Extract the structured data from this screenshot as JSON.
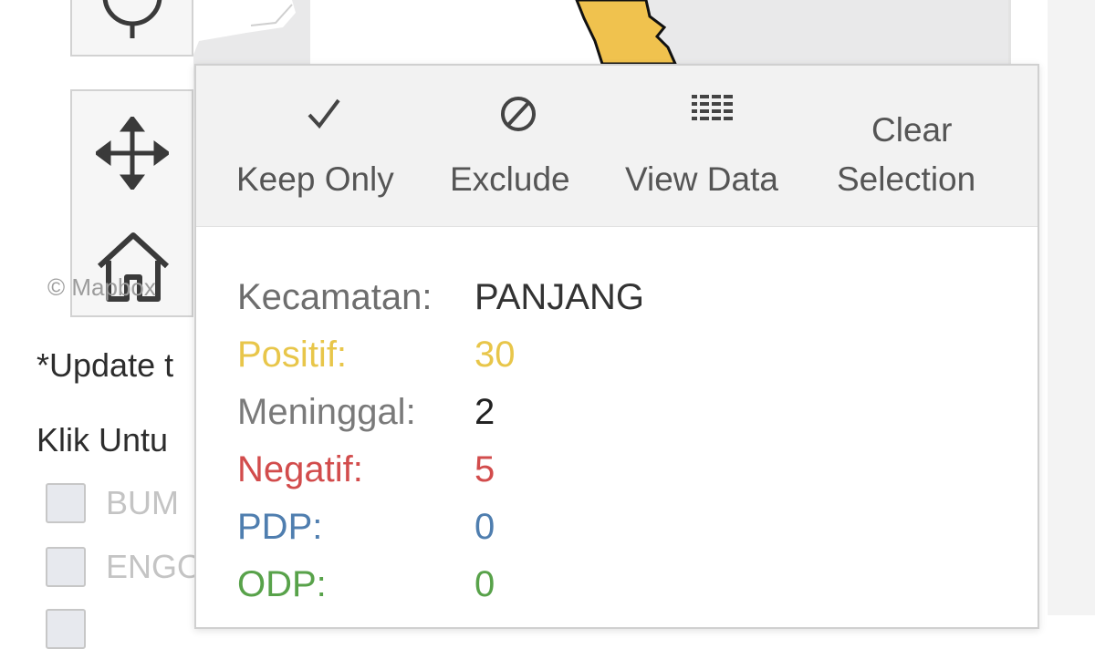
{
  "map": {
    "attribution": "© Mapbox"
  },
  "side_panel": {
    "update_note": "*Update t",
    "filter_heading": "Klik Untu",
    "filters": [
      {
        "label": "BUM",
        "checked": false
      },
      {
        "label": "ENGO",
        "checked": false
      }
    ]
  },
  "tooltip": {
    "actions": {
      "keep_only": "Keep Only",
      "exclude": "Exclude",
      "view_data": "View Data",
      "clear_line1": "Clear",
      "clear_line2": "Selection"
    },
    "details": [
      {
        "label": "Kecamatan:",
        "value": "PANJANG",
        "color": "#333333",
        "label_color": "#6e6e6e"
      },
      {
        "label": "Positif:",
        "value": "30",
        "color": "#e8c64a",
        "label_color": "#e8c64a"
      },
      {
        "label": "Meninggal:",
        "value": "2",
        "color": "#222222",
        "label_color": "#7a7a7a"
      },
      {
        "label": "Negatif:",
        "value": "5",
        "color": "#d24c4c",
        "label_color": "#d24c4c"
      },
      {
        "label": "PDP:",
        "value": "0",
        "color": "#4f7eaf",
        "label_color": "#4f7eaf"
      },
      {
        "label": "ODP:",
        "value": "0",
        "color": "#58a24a",
        "label_color": "#58a24a"
      }
    ]
  },
  "colors": {
    "map_region": "#f0c24e",
    "map_background": "#e9e9ea"
  }
}
